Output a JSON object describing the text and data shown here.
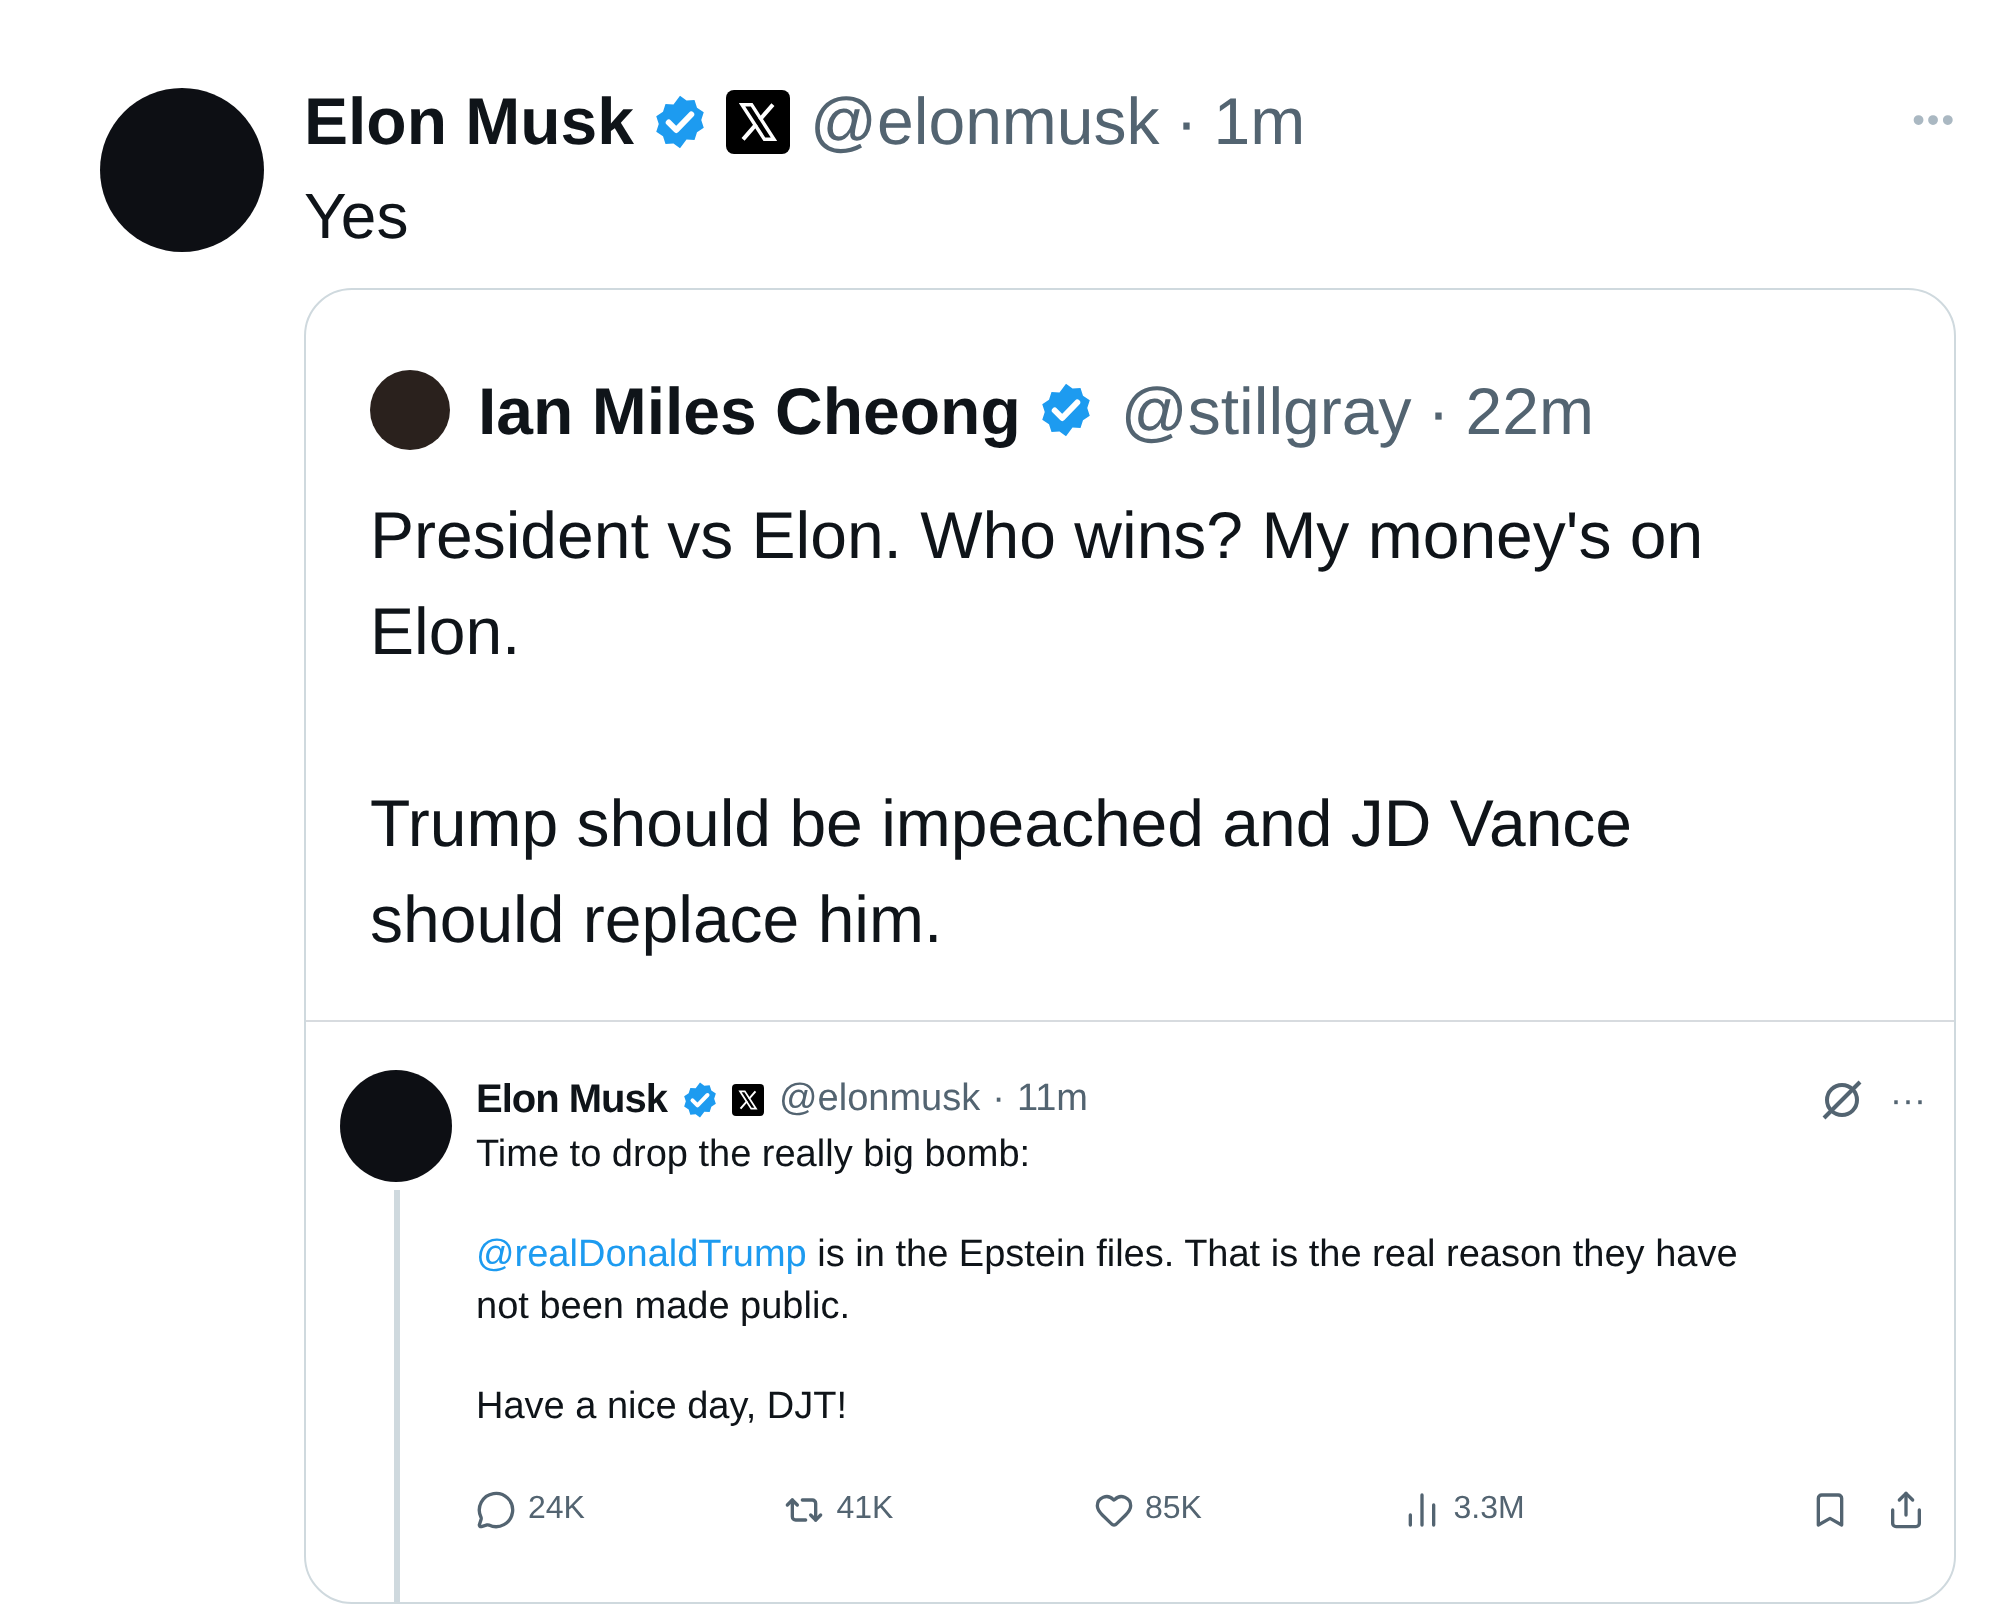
{
  "post": {
    "name": "Elon Musk",
    "handle": "@elonmusk",
    "separator": "·",
    "time": "1m",
    "more": "•••",
    "text": "Yes",
    "quote": {
      "name": "Ian Miles Cheong",
      "handle": "@stillgray",
      "separator": "·",
      "time": "22m",
      "paragraphs": [
        "President vs Elon. Who wins? My money's on Elon.",
        "Trump should be impeached and JD Vance should replace him."
      ],
      "embedded": {
        "name": "Elon Musk",
        "handle": "@elonmusk",
        "separator": "·",
        "time": "11m",
        "more": "···",
        "paragraphs": [
          {
            "text": "Time to drop the really big bomb:"
          },
          {
            "mention": "@realDonaldTrump",
            "text": " is in the Epstein files. That is the real reason they have not been made public."
          },
          {
            "text": "Have a nice day, DJT!"
          }
        ],
        "actions": [
          {
            "kind": "reply",
            "count": "24K"
          },
          {
            "kind": "repost",
            "count": "41K"
          },
          {
            "kind": "like",
            "count": "85K"
          },
          {
            "kind": "views",
            "count": "3.3M"
          },
          {
            "kind": "bookmark"
          },
          {
            "kind": "share"
          }
        ]
      }
    }
  }
}
